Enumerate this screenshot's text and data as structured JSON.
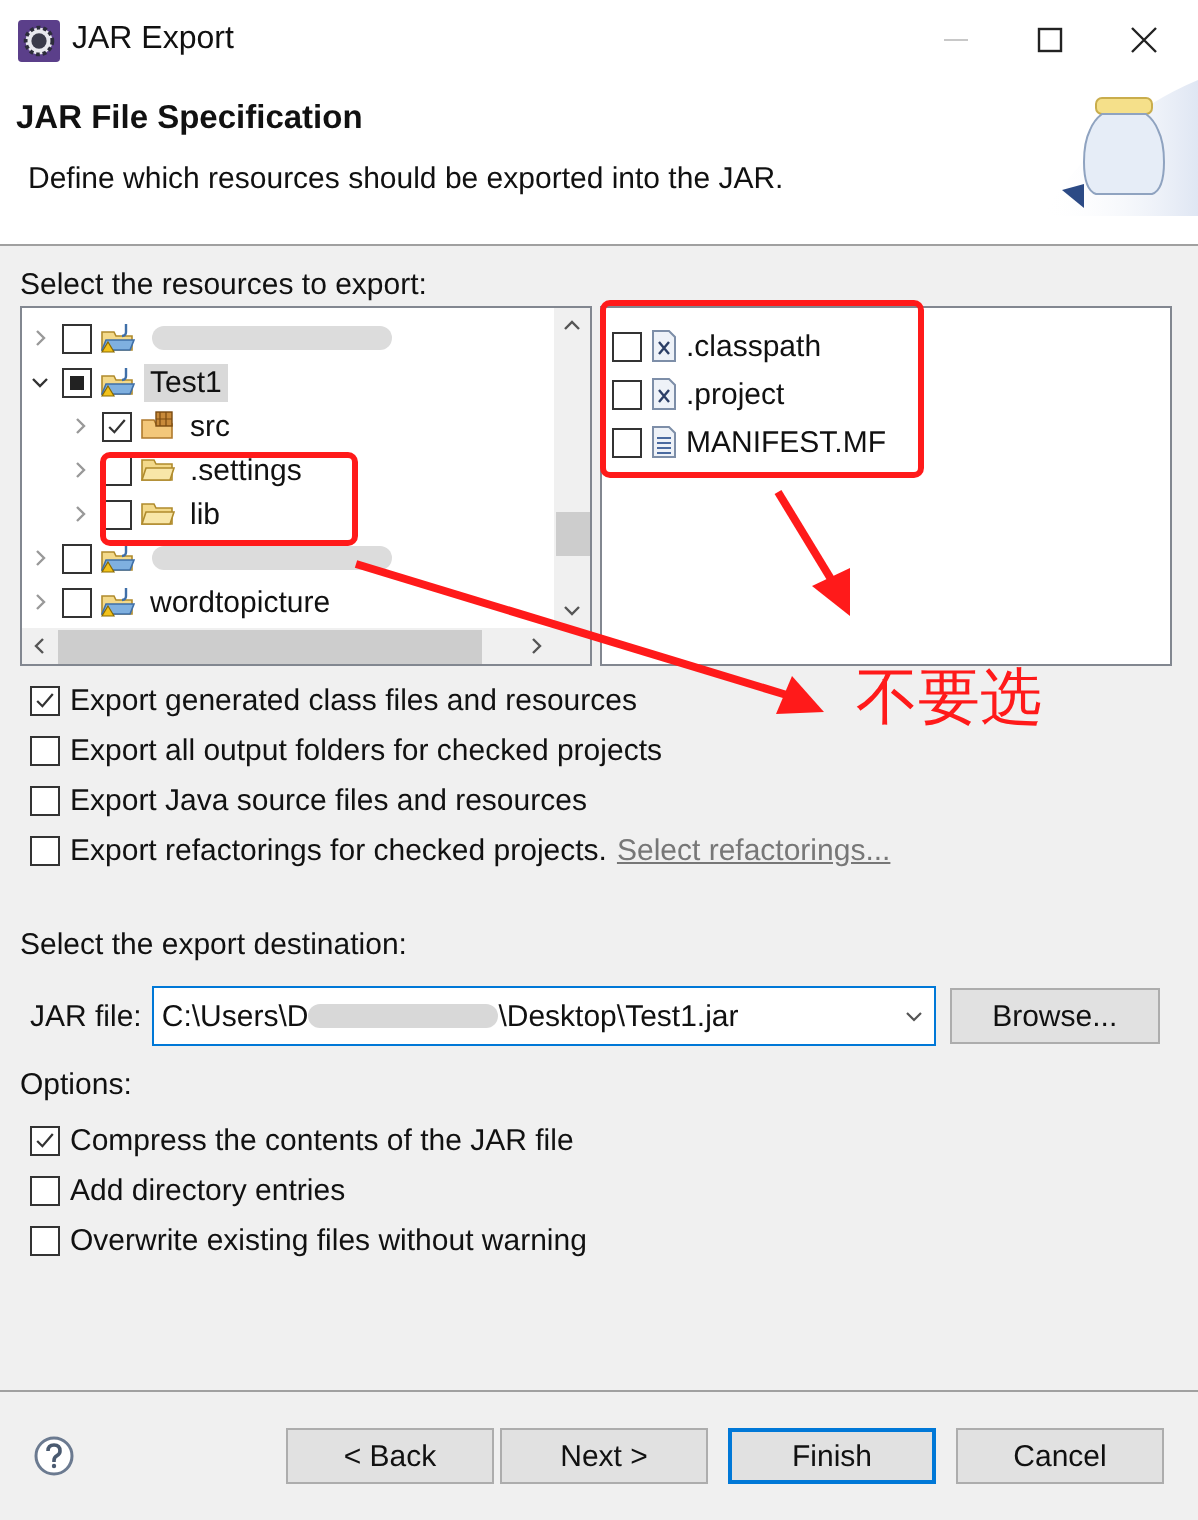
{
  "window": {
    "title": "JAR Export"
  },
  "header": {
    "title": "JAR File Specification",
    "description": "Define which resources should be exported into the JAR."
  },
  "resources": {
    "label": "Select the resources to export:",
    "tree": [
      {
        "kind": "project",
        "checked": false,
        "partial": false,
        "expanded": false,
        "selected": false
      },
      {
        "kind": "project",
        "label": "Test1",
        "checked": false,
        "partial": true,
        "expanded": true,
        "selected": true,
        "children": [
          {
            "kind": "package",
            "label": "src",
            "checked": true,
            "partial": false,
            "expanded": false,
            "selected": false
          },
          {
            "kind": "folder",
            "label": ".settings",
            "checked": false,
            "partial": false,
            "expanded": false,
            "selected": false
          },
          {
            "kind": "folder",
            "label": "lib",
            "checked": false,
            "partial": false,
            "expanded": false,
            "selected": false
          }
        ]
      },
      {
        "kind": "project",
        "checked": false,
        "partial": false,
        "expanded": false,
        "selected": false
      },
      {
        "kind": "project",
        "label": "wordtopicture",
        "checked": false,
        "partial": false,
        "expanded": false,
        "selected": false
      }
    ],
    "files": [
      {
        "kind": "xml",
        "label": ".classpath",
        "checked": false
      },
      {
        "kind": "xml",
        "label": ".project",
        "checked": false
      },
      {
        "kind": "text",
        "label": "MANIFEST.MF",
        "checked": false
      }
    ]
  },
  "export_options": [
    {
      "label": "Export generated class files and resources",
      "checked": true
    },
    {
      "label": "Export all output folders for checked projects",
      "checked": false
    },
    {
      "label": "Export Java source files and resources",
      "checked": false
    },
    {
      "label": "Export refactorings for checked projects.",
      "checked": false,
      "link": "Select refactorings..."
    }
  ],
  "destination": {
    "label": "Select the export destination:",
    "field_label": "JAR file:",
    "value_start": "C:\\Users\\D",
    "value_end": "\\Desktop\\Test1.jar",
    "browse": "Browse..."
  },
  "options": {
    "label": "Options:",
    "items": [
      {
        "label": "Compress the contents of the JAR file",
        "checked": true
      },
      {
        "label": "Add directory entries",
        "checked": false
      },
      {
        "label": "Overwrite existing files without warning",
        "checked": false
      }
    ]
  },
  "buttons": [
    {
      "label": "< Back",
      "default": false
    },
    {
      "label": "Next >",
      "default": false
    },
    {
      "label": "Finish",
      "default": true
    },
    {
      "label": "Cancel",
      "default": false
    }
  ],
  "annotation": {
    "note": "不要选"
  }
}
